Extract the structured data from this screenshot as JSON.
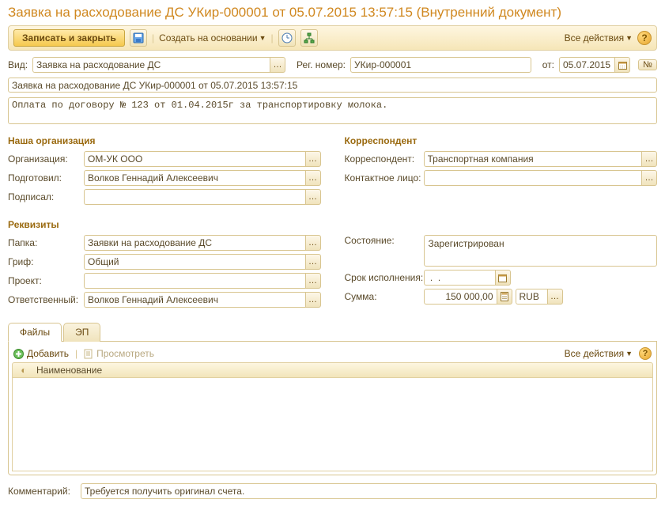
{
  "title": "Заявка на расходование ДС УКир-000001 от 05.07.2015 13:57:15 (Внутренний документ)",
  "toolbar": {
    "save_close": "Записать и закрыть",
    "create_based": "Создать на основании",
    "all_actions": "Все действия"
  },
  "top": {
    "vid_label": "Вид:",
    "vid_value": "Заявка на расходование ДС",
    "reg_label": "Рег. номер:",
    "reg_value": "УКир-000001",
    "ot_label": "от:",
    "date_value": "05.07.2015",
    "num_btn": "№",
    "description": "Заявка на расходование ДС УКир-000001 от 05.07.2015 13:57:15",
    "summary": "Оплата по договору № 123 от 01.04.2015г за транспортировку молока."
  },
  "org_group": {
    "title": "Наша организация",
    "org_label": "Организация:",
    "org_value": "ОМ-УК ООО",
    "prepared_label": "Подготовил:",
    "prepared_value": "Волков Геннадий Алексеевич",
    "signed_label": "Подписал:",
    "signed_value": ""
  },
  "corr_group": {
    "title": "Корреспондент",
    "corr_label": "Корреспондент:",
    "corr_value": "Транспортная компания",
    "contact_label": "Контактное лицо:",
    "contact_value": ""
  },
  "req_group": {
    "title": "Реквизиты",
    "folder_label": "Папка:",
    "folder_value": "Заявки на расходование ДС",
    "grif_label": "Гриф:",
    "grif_value": "Общий",
    "project_label": "Проект:",
    "project_value": "",
    "resp_label": "Ответственный:",
    "resp_value": "Волков Геннадий Алексеевич",
    "state_label": "Состояние:",
    "state_value": "Зарегистрирован",
    "deadline_label": "Срок исполнения:",
    "deadline_value": " .  .",
    "sum_label": "Сумма:",
    "sum_value": "150 000,00",
    "currency": "RUB"
  },
  "tabs": {
    "files": "Файлы",
    "signature": "ЭП",
    "add": "Добавить",
    "view": "Просмотреть",
    "all_actions": "Все действия",
    "col_name": "Наименование"
  },
  "comment": {
    "label": "Комментарий:",
    "value": "Требуется получить оригинал счета."
  }
}
